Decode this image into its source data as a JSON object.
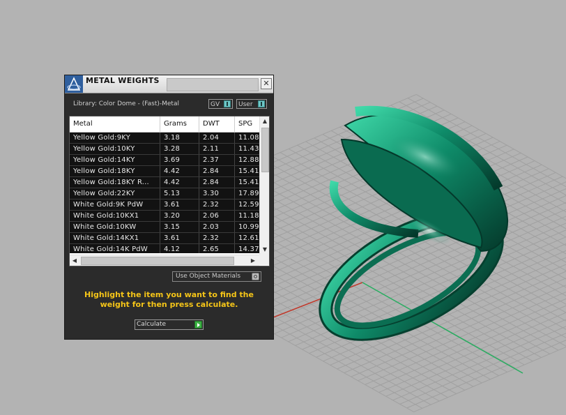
{
  "panel": {
    "title": "METAL WEIGHTS",
    "close_glyph": "✕",
    "library_label": "Library: Color Dome - (Fast)-Metal",
    "toggles": {
      "gv": "GV",
      "user": "User"
    },
    "columns": {
      "metal": "Metal",
      "grams": "Grams",
      "dwt": "DWT",
      "spg": "SPG"
    },
    "rows": [
      {
        "metal": "Yellow Gold:9KY",
        "grams": "3.18",
        "dwt": "2.04",
        "spg": "11.08"
      },
      {
        "metal": "Yellow Gold:10KY",
        "grams": "3.28",
        "dwt": "2.11",
        "spg": "11.43"
      },
      {
        "metal": "Yellow Gold:14KY",
        "grams": "3.69",
        "dwt": "2.37",
        "spg": "12.88"
      },
      {
        "metal": "Yellow Gold:18KY",
        "grams": "4.42",
        "dwt": "2.84",
        "spg": "15.41"
      },
      {
        "metal": "Yellow Gold:18KY R...",
        "grams": "4.42",
        "dwt": "2.84",
        "spg": "15.41"
      },
      {
        "metal": "Yellow Gold:22KY",
        "grams": "5.13",
        "dwt": "3.30",
        "spg": "17.89"
      },
      {
        "metal": "White Gold:9K PdW",
        "grams": "3.61",
        "dwt": "2.32",
        "spg": "12.59"
      },
      {
        "metal": "White Gold:10KX1",
        "grams": "3.20",
        "dwt": "2.06",
        "spg": "11.18"
      },
      {
        "metal": "White Gold:10KW",
        "grams": "3.15",
        "dwt": "2.03",
        "spg": "10.99"
      },
      {
        "metal": "White Gold:14KX1",
        "grams": "3.61",
        "dwt": "2.32",
        "spg": "12.61"
      },
      {
        "metal": "White Gold:14K PdW",
        "grams": "4.12",
        "dwt": "2.65",
        "spg": "14.37"
      }
    ],
    "use_object_materials_label": "Use Object Materials",
    "instruction": "Highlight the item you want to find the weight for then press calculate.",
    "calculate_label": "Calculate"
  },
  "colors": {
    "panel_bg": "#2b2b2b",
    "instruction_text": "#f5c518",
    "ring_green": "#0e8a68",
    "viewport_bg": "#b3b3b3",
    "grid_line": "#a0a0a0",
    "x_axis": "#c0392b",
    "y_axis": "#27ae60"
  },
  "icons": {
    "app_logo": "rhino-logo-icon",
    "close": "close-icon",
    "calculate": "play-arrow-icon"
  }
}
